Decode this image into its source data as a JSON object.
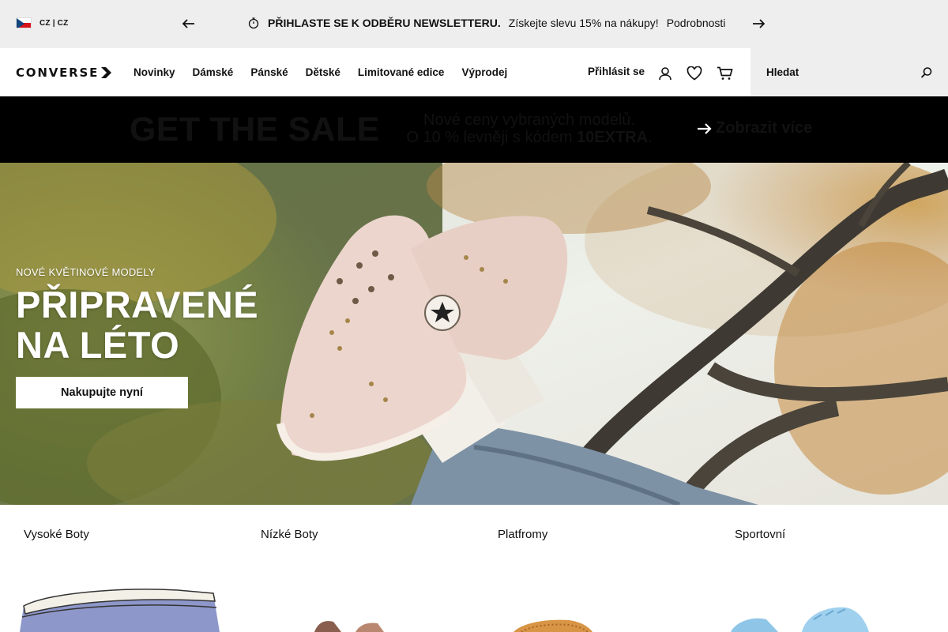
{
  "promo_bar": {
    "locale": "CZ | CZ",
    "message_bold": "PŘIHLASTE SE K ODBĚRU NEWSLETTERU.",
    "message_text": "Získejte slevu 15% na nákupy!",
    "details_link": "Podrobnosti"
  },
  "header": {
    "logo_text": "CONVERSE",
    "nav_items": [
      "Novinky",
      "Dámské",
      "Pánské",
      "Dětské",
      "Limitované edice",
      "Výprodej"
    ],
    "signin_label": "Přihlásit se",
    "search_placeholder": "Hledat"
  },
  "sale_banner": {
    "title": "GET THE SALE",
    "line1": "Nové ceny vybraných modelů.",
    "line2_prefix": "O 10 % levněji s kódem ",
    "code": "10EXTRA",
    "line2_suffix": ".",
    "cta": "Zobrazit více"
  },
  "hero": {
    "eyebrow": "NOVÉ KVĚTINOVÉ MODELY",
    "title_line1": "PŘIPRAVENÉ",
    "title_line2": "NA LÉTO",
    "button": "Nakupujte nyní"
  },
  "categories": [
    {
      "label": "Vysoké Boty"
    },
    {
      "label": "Nízké Boty"
    },
    {
      "label": "Platfromy"
    },
    {
      "label": "Sportovní"
    }
  ],
  "colors": {
    "promo_bg": "#eeeeee",
    "banner_bg": "#000000",
    "text": "#111111"
  }
}
